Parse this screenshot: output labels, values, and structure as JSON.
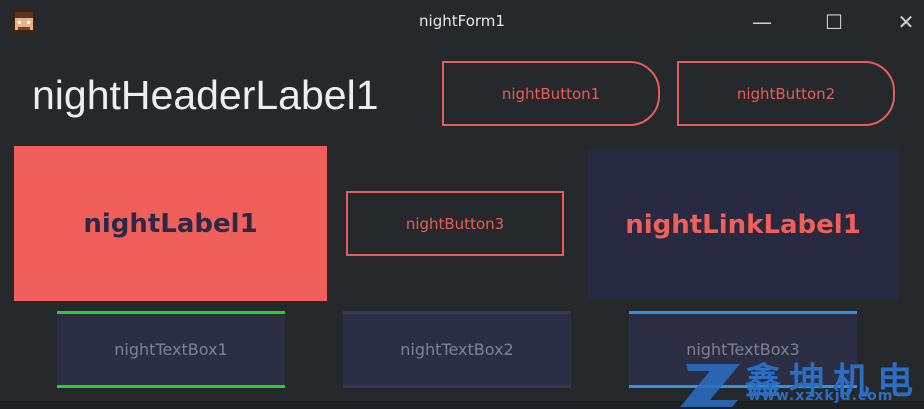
{
  "window": {
    "title": "nightForm1",
    "controls": {
      "minimize": "—",
      "maximize": "☐",
      "close": "✕"
    },
    "icon": "pixel-avatar-icon"
  },
  "header_label": "nightHeaderLabel1",
  "buttons": {
    "button1": "nightButton1",
    "button2": "nightButton2",
    "button3": "nightButton3"
  },
  "label1": "nightLabel1",
  "link_label": "nightLinkLabel1",
  "textboxes": {
    "textbox1": "nightTextBox1",
    "textbox2": "nightTextBox2",
    "textbox3": "nightTextBox3"
  },
  "watermark": {
    "text": "鑫坤机电",
    "url": "www.xzxkjd.com"
  },
  "colors": {
    "background": "#25292c",
    "accent_red": "#f05f59",
    "label_text": "#2b2a46",
    "textbox_bg": "#2c2f44",
    "textbox1_border": "#22d325",
    "textbox3_border": "#2e93e6"
  }
}
